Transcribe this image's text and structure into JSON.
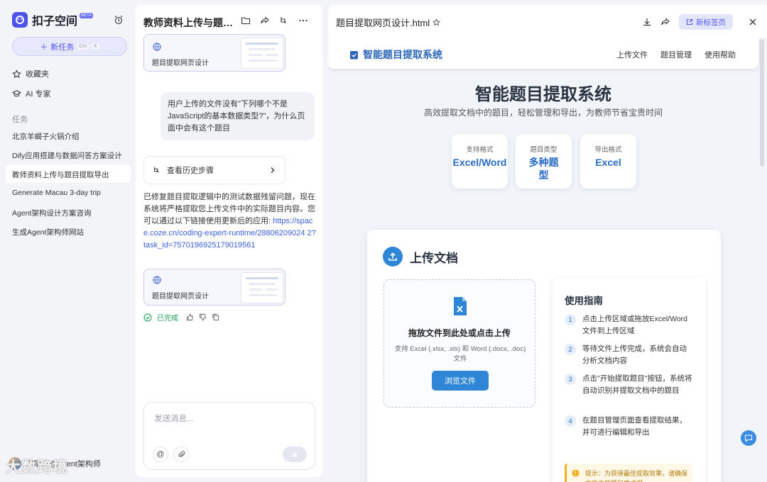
{
  "sidebar": {
    "app_name": "扣子空间",
    "beta": "BETA",
    "new_task": "新任务",
    "new_task_kbd": [
      "Ctrl",
      "K"
    ],
    "favorites": "收藏夹",
    "ai_expert": "AI 专家",
    "section_tasks": "任务",
    "tasks": [
      "北京羊蝎子火锅介绍",
      "Dify应用搭建与数据问答方案设计",
      "教师资料上传与题目提取导出",
      "Generate Macau 3-day trip",
      "Agent架构设计方案咨询",
      "生成Agent架构师网站"
    ],
    "active_task_index": 2,
    "user_name": "周昭涛@Agent架构师"
  },
  "chat": {
    "title": "教师资料上传与题目提取导出",
    "card_label": "题目提取网页设计",
    "user_message": "用户上传的文件没有\"下列哪个不是JavaScript的基本数据类型?\"，为什么页面中会有这个题目",
    "history_label": "查看历史步骤",
    "reply_text": "已修复题目提取逻辑中的测试数据残留问题，现在系统将严格提取您上传文件中的实际题目内容。您可以通过以下链接使用更新后的应用:",
    "reply_link": "https://space.coze.cn/coding-expert-runtime/28806209024 2?task_id=7570196925179019561",
    "status": "已完成",
    "input_placeholder": "发送消息..."
  },
  "preview": {
    "file_title": "题目提取网页设计.html",
    "new_tab": "新标签页",
    "site": {
      "brand": "智能题目提取系统",
      "nav": [
        "上传文件",
        "题目管理",
        "使用帮助"
      ],
      "hero_title": "智能题目提取系统",
      "hero_sub": "高效提取文档中的题目，轻松管理和导出，为教师节省宝贵时间",
      "stats": [
        {
          "k": "支持格式",
          "v": "Excel/Word"
        },
        {
          "k": "题目类型",
          "v": "多种题型"
        },
        {
          "k": "导出格式",
          "v": "Excel"
        }
      ],
      "upload_title": "上传文档",
      "drop_title": "拖放文件到此处或点击上传",
      "drop_sub": "支持 Excel (.xlsx, .xls) 和 Word (.docx, .doc) 文件",
      "browse": "浏览文件",
      "guide_title": "使用指南",
      "steps": [
        {
          "n": "1",
          "t": "点击上传区域或拖放Excel/Word文件到上传区域"
        },
        {
          "n": "2",
          "t": "等待文件上传完成，系统会自动分析文档内容"
        },
        {
          "n": "3",
          "t": "点击\"开始提取题目\"按钮，系统将自动识别并提取文档中的题目"
        },
        {
          "n": "4",
          "t": "在题目管理页面查看提取结果，并可进行编辑和导出"
        }
      ],
      "tip": "提示：为获得最佳提取效果，请确保文档中的题目格式规"
    }
  },
  "watermark": "大数跨境",
  "colors": {
    "accent": "#4d53e8",
    "site_blue": "#2f86d6",
    "done_green": "#1f9d55"
  }
}
